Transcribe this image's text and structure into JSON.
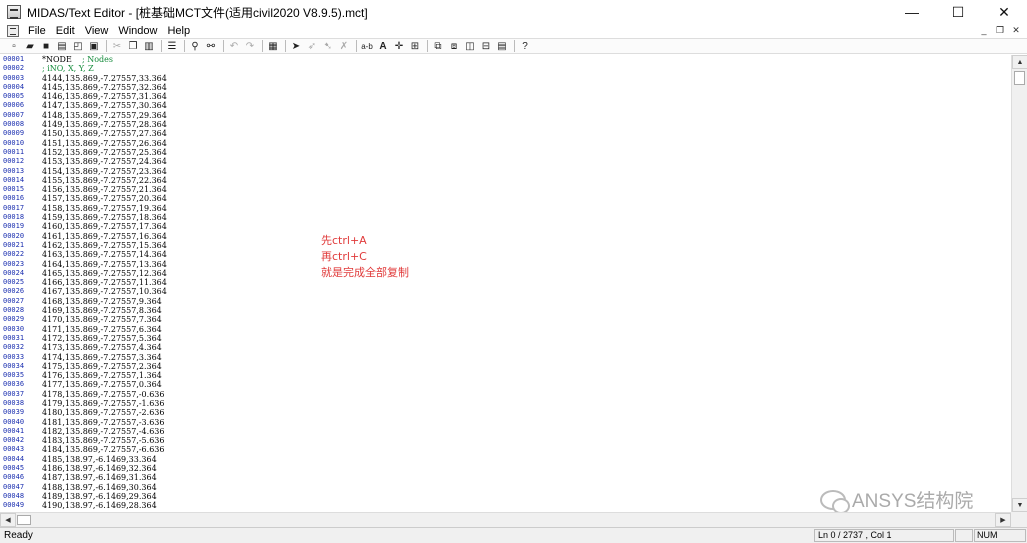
{
  "window": {
    "title": "MIDAS/Text Editor - [桩基础MCT文件(适用civil2020 V8.9.5).mct]",
    "controls": {
      "minimize": "—",
      "maximize": "☐",
      "close": "✕"
    }
  },
  "menu": {
    "items": [
      "File",
      "Edit",
      "View",
      "Window",
      "Help"
    ],
    "mdi_controls": {
      "minimize": "_",
      "restore": "❐",
      "close": "✕"
    }
  },
  "toolbar": {
    "icons": [
      "new-file-icon",
      "open-folder-icon",
      "save-icon",
      "print-icon",
      "print-preview-icon",
      "page-setup-icon",
      "cut-icon",
      "copy-icon",
      "paste-icon",
      "column-view-icon",
      "find-icon",
      "replace-icon",
      "undo-icon",
      "redo-icon",
      "block-icon",
      "marker-icon",
      "bookmark-toggle-icon",
      "bookmark-next-icon",
      "bookmark-clear-icon",
      "ab-icon",
      "font-icon",
      "goto-icon",
      "grid-icon",
      "window-cascade-icon",
      "window-tile-icon",
      "window-vertical-icon",
      "window-horizontal-icon",
      "window-arrange-icon",
      "help-icon"
    ]
  },
  "editor": {
    "line_numbers": [
      "00001",
      "00002",
      "00003",
      "00004",
      "00005",
      "00006",
      "00007",
      "00008",
      "00009",
      "00010",
      "00011",
      "00012",
      "00013",
      "00014",
      "00015",
      "00016",
      "00017",
      "00018",
      "00019",
      "00020",
      "00021",
      "00022",
      "00023",
      "00024",
      "00025",
      "00026",
      "00027",
      "00028",
      "00029",
      "00030",
      "00031",
      "00032",
      "00033",
      "00034",
      "00035",
      "00036",
      "00037",
      "00038",
      "00039",
      "00040",
      "00041",
      "00042",
      "00043",
      "00044",
      "00045",
      "00046",
      "00047",
      "00048",
      "00049"
    ],
    "header_lines": [
      {
        "keyword": "*NODE",
        "comment": "; Nodes"
      },
      {
        "keyword": "",
        "comment": "; iNO, X, Y, Z"
      }
    ],
    "lines": [
      "4144,135.869,-7.27557,33.364",
      "4145,135.869,-7.27557,32.364",
      "4146,135.869,-7.27557,31.364",
      "4147,135.869,-7.27557,30.364",
      "4148,135.869,-7.27557,29.364",
      "4149,135.869,-7.27557,28.364",
      "4150,135.869,-7.27557,27.364",
      "4151,135.869,-7.27557,26.364",
      "4152,135.869,-7.27557,25.364",
      "4153,135.869,-7.27557,24.364",
      "4154,135.869,-7.27557,23.364",
      "4155,135.869,-7.27557,22.364",
      "4156,135.869,-7.27557,21.364",
      "4157,135.869,-7.27557,20.364",
      "4158,135.869,-7.27557,19.364",
      "4159,135.869,-7.27557,18.364",
      "4160,135.869,-7.27557,17.364",
      "4161,135.869,-7.27557,16.364",
      "4162,135.869,-7.27557,15.364",
      "4163,135.869,-7.27557,14.364",
      "4164,135.869,-7.27557,13.364",
      "4165,135.869,-7.27557,12.364",
      "4166,135.869,-7.27557,11.364",
      "4167,135.869,-7.27557,10.364",
      "4168,135.869,-7.27557,9.364",
      "4169,135.869,-7.27557,8.364",
      "4170,135.869,-7.27557,7.364",
      "4171,135.869,-7.27557,6.364",
      "4172,135.869,-7.27557,5.364",
      "4173,135.869,-7.27557,4.364",
      "4174,135.869,-7.27557,3.364",
      "4175,135.869,-7.27557,2.364",
      "4176,135.869,-7.27557,1.364",
      "4177,135.869,-7.27557,0.364",
      "4178,135.869,-7.27557,-0.636",
      "4179,135.869,-7.27557,-1.636",
      "4180,135.869,-7.27557,-2.636",
      "4181,135.869,-7.27557,-3.636",
      "4182,135.869,-7.27557,-4.636",
      "4183,135.869,-7.27557,-5.636",
      "4184,135.869,-7.27557,-6.636",
      "4185,138.97,-6.1469,33.364",
      "4186,138.97,-6.1469,32.364",
      "4187,138.97,-6.1469,31.364",
      "4188,138.97,-6.1469,30.364",
      "4189,138.97,-6.1469,29.364",
      "4190,138.97,-6.1469,28.364"
    ]
  },
  "annotation": {
    "lines": [
      "先ctrl+A",
      "再ctrl+C",
      "就是完成全部复制"
    ],
    "color": "#e03a3a"
  },
  "watermark": {
    "text": "ANSYS结构院"
  },
  "scrollbars": {
    "up": "▲",
    "down": "▼",
    "left": "◀",
    "right": "▶"
  },
  "status": {
    "text": "Ready",
    "position": "Ln 0 / 2737 , Col 1",
    "indicator_blank": "",
    "indicator": "NUM"
  }
}
